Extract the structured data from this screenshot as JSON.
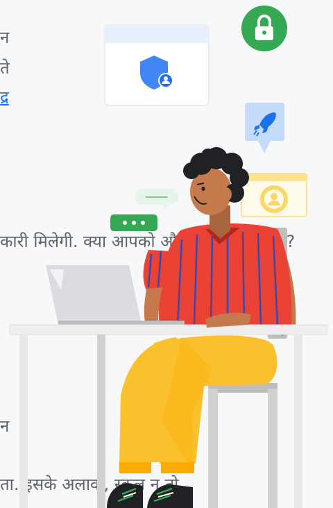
{
  "background_text": {
    "line_1": "न",
    "line_2": "ते",
    "link_fragment": "द्र",
    "line_4": "कारी मिलेगी. क्या आपको और जानकारी चाहिए?",
    "line_5": "न",
    "line_6": "ता. इसके अलावा, स्कूल न तो"
  },
  "illustration": {
    "icons": [
      "lock-icon",
      "shield-user-icon",
      "rocket-icon",
      "user-circle-icon",
      "chat-dots-icon",
      "chat-line-icon"
    ],
    "colors": {
      "green": "#34a853",
      "blue": "#4285f4",
      "shirt_red": "#ea4335",
      "pants_yellow": "#fbc02d",
      "skin": "#c47a4d",
      "hair": "#202124",
      "desk": "#eeeeee",
      "chair": "#bdbdbd"
    }
  }
}
